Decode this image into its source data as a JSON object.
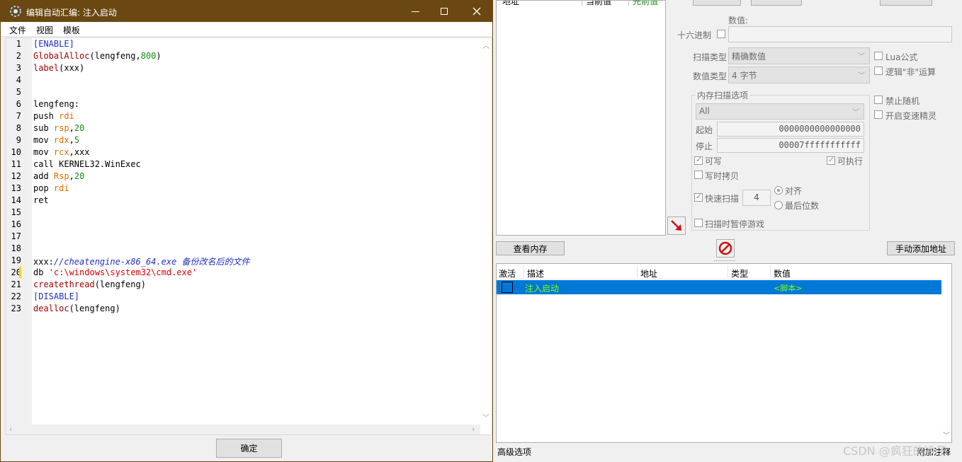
{
  "editor": {
    "title": "编辑自动汇编: 注入启动",
    "menu": [
      "文件",
      "视图",
      "模板"
    ],
    "confirm_label": "确定",
    "lines": [
      {
        "n": "1",
        "parts": [
          {
            "t": "[ENABLE]",
            "c": "sb"
          }
        ]
      },
      {
        "n": "2",
        "parts": [
          {
            "t": "GlobalAlloc",
            "c": "fn"
          },
          {
            "t": "(lengfeng,",
            "c": ""
          },
          {
            "t": "800",
            "c": "num"
          },
          {
            "t": ")",
            "c": ""
          }
        ]
      },
      {
        "n": "3",
        "parts": [
          {
            "t": "label",
            "c": "fn"
          },
          {
            "t": "(xxx)",
            "c": ""
          }
        ]
      },
      {
        "n": "4",
        "parts": []
      },
      {
        "n": "5",
        "parts": []
      },
      {
        "n": "6",
        "parts": [
          {
            "t": "lengfeng:",
            "c": ""
          }
        ]
      },
      {
        "n": "7",
        "parts": [
          {
            "t": "push ",
            "c": ""
          },
          {
            "t": "rdi",
            "c": "reg"
          }
        ]
      },
      {
        "n": "8",
        "parts": [
          {
            "t": "sub ",
            "c": ""
          },
          {
            "t": "rsp",
            "c": "reg"
          },
          {
            "t": ",",
            "c": ""
          },
          {
            "t": "20",
            "c": "num"
          }
        ]
      },
      {
        "n": "9",
        "parts": [
          {
            "t": "mov ",
            "c": ""
          },
          {
            "t": "rdx",
            "c": "reg"
          },
          {
            "t": ",",
            "c": ""
          },
          {
            "t": "5",
            "c": "num"
          }
        ]
      },
      {
        "n": "10",
        "parts": [
          {
            "t": "mov ",
            "c": ""
          },
          {
            "t": "rcx",
            "c": "reg"
          },
          {
            "t": ",xxx",
            "c": ""
          }
        ]
      },
      {
        "n": "11",
        "parts": [
          {
            "t": "call KERNEL32.WinExec",
            "c": ""
          }
        ]
      },
      {
        "n": "12",
        "parts": [
          {
            "t": "add ",
            "c": ""
          },
          {
            "t": "Rsp",
            "c": "reg"
          },
          {
            "t": ",",
            "c": ""
          },
          {
            "t": "20",
            "c": "num"
          }
        ]
      },
      {
        "n": "13",
        "parts": [
          {
            "t": "pop ",
            "c": ""
          },
          {
            "t": "rdi",
            "c": "reg"
          }
        ]
      },
      {
        "n": "14",
        "parts": [
          {
            "t": "ret",
            "c": ""
          }
        ]
      },
      {
        "n": "15",
        "parts": []
      },
      {
        "n": "16",
        "parts": []
      },
      {
        "n": "17",
        "parts": []
      },
      {
        "n": "18",
        "parts": []
      },
      {
        "n": "19",
        "parts": [
          {
            "t": "xxx:",
            "c": ""
          },
          {
            "t": "//cheatengine-x86_64.exe 备份改名后的文件",
            "c": "com"
          }
        ]
      },
      {
        "n": "20",
        "parts": [
          {
            "t": "db ",
            "c": ""
          },
          {
            "t": "'c:\\windows\\system32\\cmd.exe'",
            "c": "str"
          }
        ]
      },
      {
        "n": "21",
        "parts": [
          {
            "t": "createthread",
            "c": "fn"
          },
          {
            "t": "(lengfeng)",
            "c": ""
          }
        ]
      },
      {
        "n": "22",
        "parts": [
          {
            "t": "[DISABLE]",
            "c": "sb"
          }
        ]
      },
      {
        "n": "23",
        "parts": [
          {
            "t": "dealloc",
            "c": "fn"
          },
          {
            "t": "(lengfeng)",
            "c": ""
          }
        ]
      }
    ]
  },
  "scan": {
    "top_headers": [
      "地址",
      "当前值",
      "先前值"
    ],
    "value_label": "数值:",
    "hex_label": "十六进制",
    "scan_type_label": "扫描类型",
    "scan_type_value": "精确数值",
    "value_type_label": "数值类型",
    "value_type_value": "4 字节",
    "lua_label": "Lua公式",
    "not_label": "逻辑\"非\"运算",
    "mem_group_label": "内存扫描选项",
    "region_value": "All",
    "start_label": "起始",
    "start_value": "0000000000000000",
    "stop_label": "停止",
    "stop_value": "00007fffffffffff",
    "writable_label": "可写",
    "executable_label": "可执行",
    "cow_label": "写时拷贝",
    "fast_scan_label": "快速扫描",
    "fast_scan_value": "4",
    "align_label": "对齐",
    "last_digits_label": "最后位数",
    "pause_label": "扫描时暂停游戏",
    "no_random_label": "禁止随机",
    "speedhack_label": "开启变速精灵"
  },
  "buttons": {
    "view_memory": "查看内存",
    "add_address": "手动添加地址"
  },
  "table": {
    "headers": [
      "激活",
      "描述",
      "地址",
      "类型",
      "数值"
    ],
    "rows": [
      {
        "desc": "注入启动",
        "address": "",
        "type": "",
        "value": "<脚本>"
      }
    ]
  },
  "status": {
    "advanced": "高级选项",
    "table_extras": "附加注释",
    "watermark": "CSDN @疯狂的冷子"
  },
  "colors": {
    "titlebar": "#6b4812",
    "selection": "#0078d7",
    "selection_text": "#7fff00"
  },
  "icons": {
    "app_icon": "cheat-engine-icon",
    "minimize": "minimize-icon",
    "maximize": "maximize-icon",
    "close": "close-icon",
    "arrow_button": "red-arrow-icon",
    "stop_button": "no-entry-icon"
  }
}
